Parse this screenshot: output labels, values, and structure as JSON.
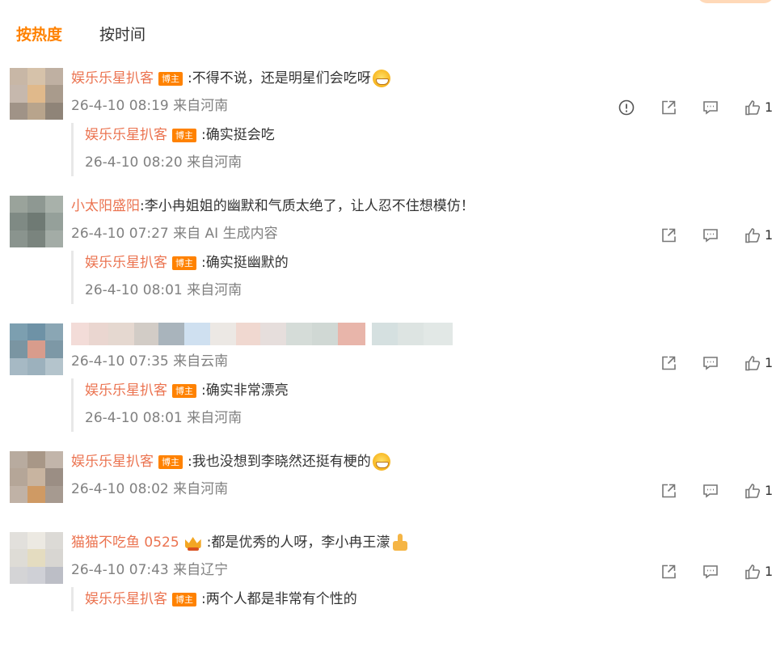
{
  "sort": {
    "hot": "按热度",
    "time": "按时间"
  },
  "comments": [
    {
      "user": "娱乐乐星扒客",
      "badge": "博主",
      "text": ":不得不说，还是明星们会吃呀",
      "meta": "26-4-10 08:19 来自河南",
      "likes": "1",
      "reply": {
        "user": "娱乐乐星扒客",
        "badge": "博主",
        "text": ":确实挺会吃",
        "meta": "26-4-10 08:20 来自河南"
      }
    },
    {
      "user": "小太阳盛阳",
      "text": ":李小冉姐姐的幽默和气质太绝了，让人忍不住想模仿！",
      "meta": "26-4-10 07:27 来自 AI 生成内容",
      "likes": "1",
      "reply": {
        "user": "娱乐乐星扒客",
        "badge": "博主",
        "text": ":确实挺幽默的",
        "meta": "26-4-10 08:01 来自河南"
      }
    },
    {
      "meta": "26-4-10 07:35 来自云南",
      "likes": "1",
      "reply": {
        "user": "娱乐乐星扒客",
        "badge": "博主",
        "text": ":确实非常漂亮",
        "meta": "26-4-10 08:01 来自河南"
      }
    },
    {
      "user": "娱乐乐星扒客",
      "badge": "博主",
      "text": ":我也没想到李晓然还挺有梗的",
      "meta": "26-4-10 08:02 来自河南",
      "likes": "1"
    },
    {
      "user": "猫猫不吃鱼 0525",
      "text": ":都是优秀的人呀，李小冉王濛",
      "meta": "26-4-10 07:43 来自辽宁",
      "likes": "1",
      "reply": {
        "user": "娱乐乐星扒客",
        "badge": "博主",
        "text": ":两个人都是非常有个性的"
      }
    }
  ],
  "icons": {
    "report": "report-icon",
    "share": "share-icon",
    "comment": "comment-icon",
    "like": "like-icon",
    "grin": "grin-emoji-icon",
    "thumbsup": "thumbs-up-emoji-icon",
    "crown": "crown-icon"
  },
  "colors": {
    "accent": "#ff8200",
    "username": "#eb7350",
    "meta": "#808080",
    "text": "#333333"
  }
}
